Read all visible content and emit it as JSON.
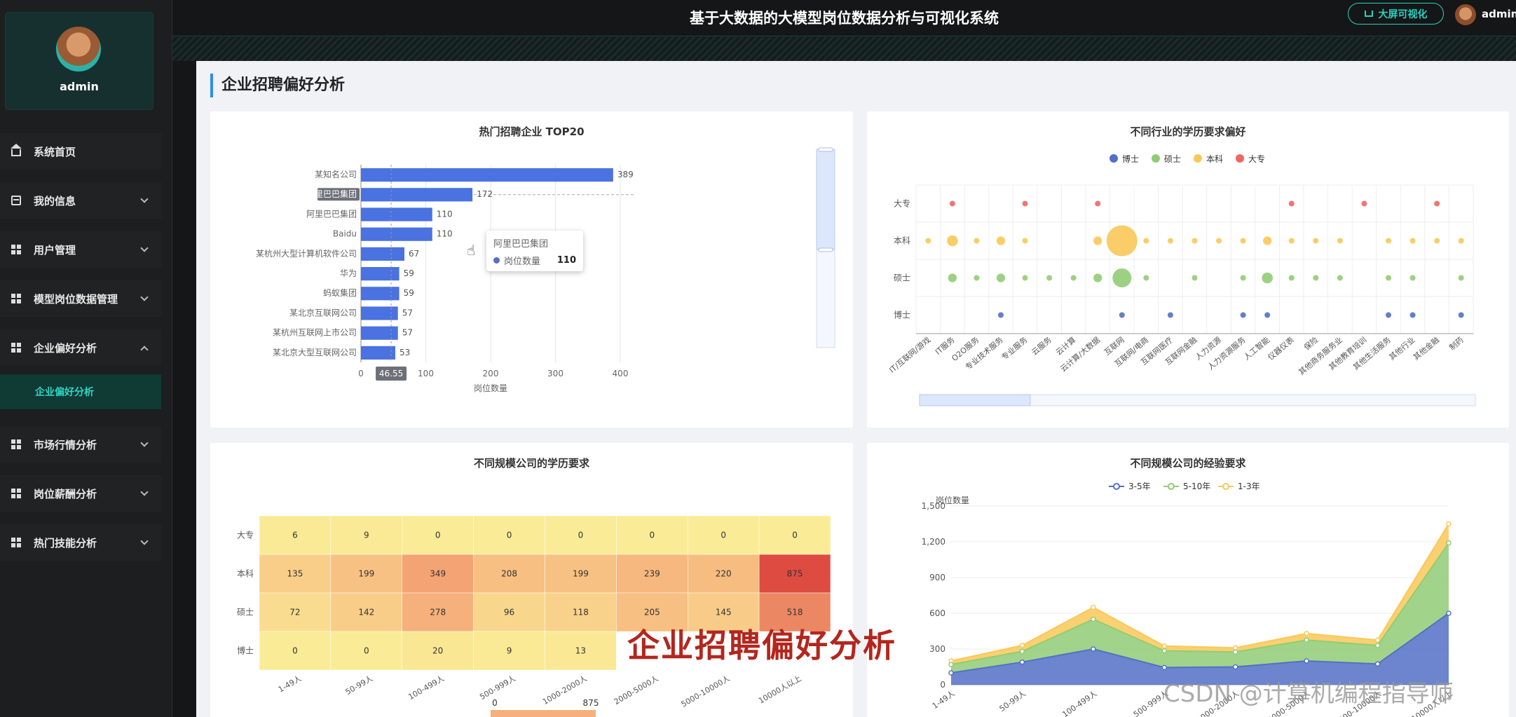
{
  "user": {
    "name": "admin"
  },
  "header": {
    "title": "基于大数据的大模型岗位数据分析与可视化系统",
    "big_screen_label": "大屏可视化",
    "user_label": "admin"
  },
  "sidebar": {
    "items": [
      {
        "label": "系统首页",
        "icon": "home-icon"
      },
      {
        "label": "我的信息",
        "icon": "info-card-icon"
      },
      {
        "label": "用户管理",
        "icon": "grid-icon"
      },
      {
        "label": "模型岗位数据管理",
        "icon": "grid-icon"
      },
      {
        "label": "企业偏好分析",
        "icon": "grid-icon",
        "expanded": true,
        "sub": "企业偏好分析"
      },
      {
        "label": "市场行情分析",
        "icon": "grid-icon"
      },
      {
        "label": "岗位薪酬分析",
        "icon": "grid-icon"
      },
      {
        "label": "热门技能分析",
        "icon": "grid-icon"
      }
    ]
  },
  "page": {
    "title": "企业招聘偏好分析"
  },
  "overlay_caption": "企业招聘偏好分析",
  "watermark": "CSDN @计算机编程指导师",
  "chart_data": [
    {
      "type": "bar",
      "title": "热门招聘企业 TOP20",
      "orientation": "horizontal",
      "categories": [
        "某知名公司",
        "阿里巴巴集团",
        "阿里巴巴集团",
        "Baidu",
        "某杭州大型计算机软件公司",
        "华为",
        "蚂蚁集团",
        "某北京互联网公司",
        "某杭州互联网上市公司",
        "某北京大型互联网公司"
      ],
      "values": [
        389,
        172,
        110,
        110,
        67,
        59,
        59,
        57,
        57,
        53
      ],
      "xlabel": "岗位数量",
      "xlim": [
        0,
        400
      ],
      "xticks": [
        "0",
        "100",
        "200",
        "300",
        "400"
      ],
      "axis_pointer": "46.55",
      "highlight_label": "阿里巴巴集团",
      "tooltip": {
        "name": "阿里巴巴集团",
        "series": "岗位数量",
        "value": "110"
      },
      "color": "#4a72e0"
    },
    {
      "type": "scatter",
      "title": "不同行业的学历要求偏好",
      "legend": [
        "博士",
        "硕士",
        "本科",
        "大专"
      ],
      "colors": [
        "#5470c6",
        "#91cc75",
        "#fac858",
        "#ee6666"
      ],
      "y_categories": [
        "大专",
        "本科",
        "硕士",
        "博士"
      ],
      "x_categories": [
        "IT/互联网/游戏",
        "IT服务",
        "O2O服务",
        "专业技术服务",
        "专业服务",
        "云服务",
        "云计算",
        "云计算/大数据",
        "互联网",
        "互联网/电商",
        "互联网医疗",
        "互联网金融",
        "人力资源",
        "人力资源服务",
        "人工智能",
        "仪器仪表",
        "保险",
        "其他商务服务业",
        "其他教育培训",
        "其他生活服务",
        "其他行业",
        "其他金融",
        "制药"
      ],
      "points": {
        "大专": [
          [
            1,
            1
          ],
          [
            4,
            1
          ],
          [
            7,
            1
          ],
          [
            15,
            1
          ],
          [
            18,
            1
          ],
          [
            21,
            1
          ]
        ],
        "本科": [
          [
            0,
            1
          ],
          [
            1,
            3
          ],
          [
            2,
            1
          ],
          [
            3,
            2
          ],
          [
            4,
            1
          ],
          [
            7,
            2
          ],
          [
            8,
            20
          ],
          [
            9,
            1
          ],
          [
            10,
            1
          ],
          [
            11,
            1
          ],
          [
            12,
            1
          ],
          [
            13,
            1
          ],
          [
            14,
            2
          ],
          [
            15,
            1
          ],
          [
            16,
            1
          ],
          [
            17,
            1
          ],
          [
            19,
            1
          ],
          [
            20,
            1
          ],
          [
            21,
            1
          ],
          [
            22,
            1
          ]
        ],
        "硕士": [
          [
            1,
            2
          ],
          [
            2,
            1
          ],
          [
            3,
            2
          ],
          [
            4,
            1
          ],
          [
            5,
            1
          ],
          [
            6,
            1
          ],
          [
            7,
            2
          ],
          [
            8,
            8
          ],
          [
            9,
            1
          ],
          [
            11,
            1
          ],
          [
            13,
            1
          ],
          [
            14,
            3
          ],
          [
            15,
            1
          ],
          [
            16,
            1
          ],
          [
            17,
            1
          ],
          [
            19,
            1
          ],
          [
            20,
            1
          ],
          [
            22,
            1
          ]
        ],
        "博士": [
          [
            3,
            1
          ],
          [
            8,
            1
          ],
          [
            10,
            1
          ],
          [
            13,
            1
          ],
          [
            14,
            1
          ],
          [
            19,
            1
          ],
          [
            20,
            1
          ],
          [
            22,
            1
          ]
        ]
      }
    },
    {
      "type": "heatmap",
      "title": "不同规模公司的学历要求",
      "x_categories": [
        "1-49人",
        "50-99人",
        "100-499人",
        "500-999人",
        "1000-2000人",
        "2000-5000人",
        "5000-10000人",
        "10000人以上"
      ],
      "y_categories": [
        "大专",
        "本科",
        "硕士",
        "博士"
      ],
      "values": [
        [
          6,
          9,
          0,
          0,
          0,
          0,
          0,
          0
        ],
        [
          135,
          199,
          349,
          208,
          199,
          239,
          220,
          875
        ],
        [
          72,
          142,
          278,
          96,
          118,
          205,
          145,
          518
        ],
        [
          0,
          0,
          20,
          9,
          13,
          null,
          null,
          null
        ]
      ],
      "visual_map": [
        "0",
        "875"
      ]
    },
    {
      "type": "area",
      "title": "不同规模公司的经验要求",
      "ylabel": "岗位数量",
      "ylim": [
        0,
        1500
      ],
      "yticks": [
        "0",
        "300",
        "600",
        "900",
        "1,200",
        "1,500"
      ],
      "categories": [
        "1-49人",
        "50-99人",
        "100-499人",
        "500-999人",
        "1000-2000人",
        "2000-5000人",
        "5000-10000人",
        "10000人以上"
      ],
      "stacked": true,
      "series": [
        {
          "name": "3-5年",
          "color": "#5470c6",
          "values": [
            100,
            190,
            300,
            145,
            150,
            200,
            175,
            600
          ]
        },
        {
          "name": "5-10年",
          "color": "#91cc75",
          "values": [
            70,
            90,
            250,
            140,
            125,
            175,
            155,
            590
          ]
        },
        {
          "name": "1-3年",
          "color": "#fac858",
          "values": [
            30,
            50,
            100,
            40,
            35,
            55,
            45,
            160
          ]
        }
      ]
    }
  ]
}
